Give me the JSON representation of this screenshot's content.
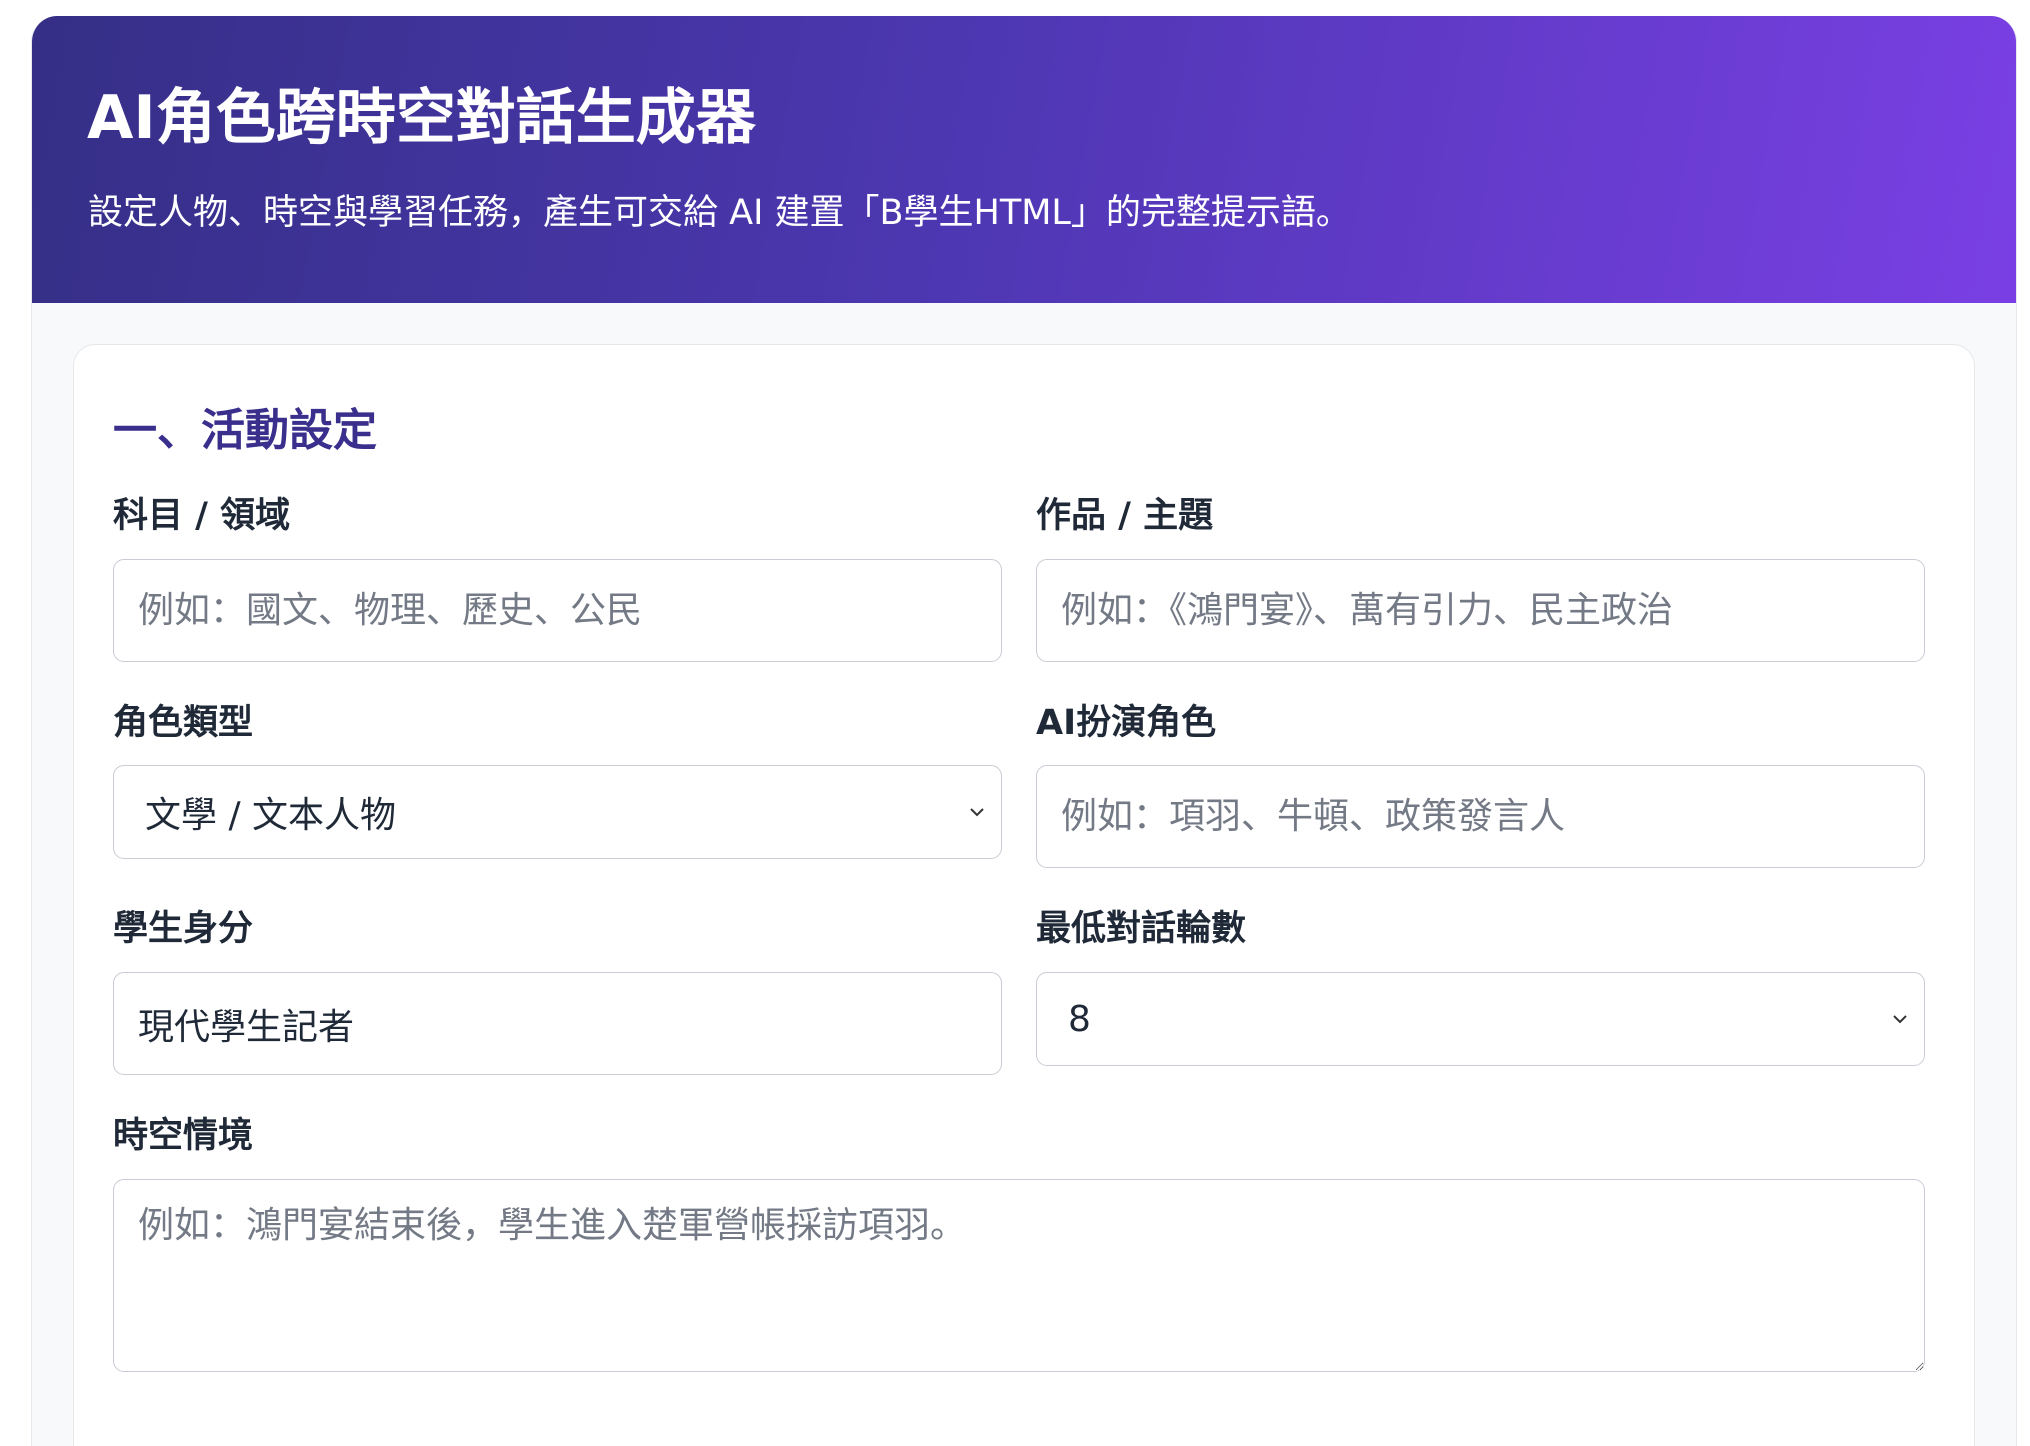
{
  "header": {
    "title": "AI角色跨時空對話生成器",
    "subtitle": "設定人物、時空與學習任務，產生可交給 AI 建置「B學生HTML」的完整提示語。"
  },
  "section": {
    "title": "一、活動設定"
  },
  "fields": {
    "subject": {
      "label": "科目 / 領域",
      "placeholder": "例如：國文、物理、歷史、公民",
      "value": ""
    },
    "work": {
      "label": "作品 / 主題",
      "placeholder": "例如：《鴻門宴》、萬有引力、民主政治",
      "value": ""
    },
    "role_type": {
      "label": "角色類型",
      "selected": "文學 / 文本人物"
    },
    "ai_role": {
      "label": "AI扮演角色",
      "placeholder": "例如：項羽、牛頓、政策發言人",
      "value": ""
    },
    "student_identity": {
      "label": "學生身分",
      "value": "現代學生記者",
      "placeholder": ""
    },
    "min_rounds": {
      "label": "最低對話輪數",
      "selected": "8"
    },
    "context": {
      "label": "時空情境",
      "placeholder": "例如：鴻門宴結束後，學生進入楚軍營帳採訪項羽。",
      "value": ""
    }
  },
  "icons": {
    "select_arrow": "chevron-down-icon"
  },
  "colors": {
    "header_gradient_start": "#352f86",
    "header_gradient_end": "#7a3fe4",
    "section_title": "#3a2f8c",
    "input_border": "#c9ccd4"
  }
}
